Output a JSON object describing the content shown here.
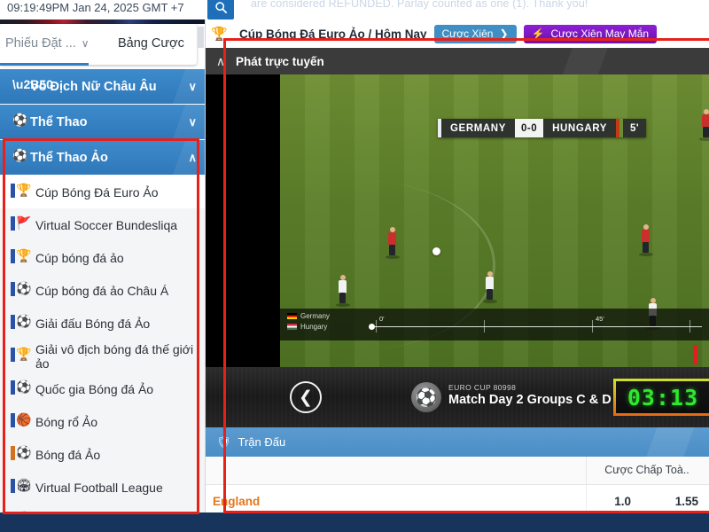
{
  "topbar": {
    "clock": "09:19:49PM Jan 24, 2025 GMT +7",
    "ticker": "are considered REFUNDED. Parlay counted as one (1). Thank you!",
    "search_icon": "search-icon"
  },
  "sidebar": {
    "tabs": {
      "bet_slip": "Phiếu Đặt ...",
      "bet_slip_chevron": "∨",
      "bet_board": "Bảng Cược"
    },
    "groups": [
      {
        "label": "Vô Địch Nữ Châu Âu",
        "chevron": "∨",
        "icon": "trophy-star-icon",
        "expanded": false
      },
      {
        "label": "Thể Thao",
        "chevron": "∨",
        "icon": "sports-ball-icon",
        "expanded": false
      },
      {
        "label": "Thể Thao Ảo",
        "chevron": "∧",
        "icon": "virtual-sports-icon",
        "expanded": true
      }
    ],
    "items": [
      {
        "label": "Cúp Bóng Đá Euro Ảo",
        "icon": "euro-cup-icon",
        "bar": "#2a53a8",
        "glyph": "🏆"
      },
      {
        "label": "Virtual Soccer Bundesliqa",
        "icon": "bundesliga-icon",
        "bar": "#2a53a8",
        "glyph": "🚩"
      },
      {
        "label": "Cúp bóng đá ảo",
        "icon": "virtual-cup-icon",
        "bar": "#2a53a8",
        "glyph": "🏆"
      },
      {
        "label": "Cúp bóng đá ảo Châu Á",
        "icon": "asia-cup-icon",
        "bar": "#2a53a8",
        "glyph": "⚽"
      },
      {
        "label": "Giải đấu Bóng đá Ảo",
        "icon": "virtual-league-icon",
        "bar": "#2a53a8",
        "glyph": "⚽"
      },
      {
        "label": "Giải vô địch bóng đá thế giới ảo",
        "icon": "world-cup-icon",
        "bar": "#2a53a8",
        "glyph": "🏆"
      },
      {
        "label": "Quốc gia Bóng đá Ảo",
        "icon": "nations-icon",
        "bar": "#2a53a8",
        "glyph": "⚽"
      },
      {
        "label": "Bóng rổ Ảo",
        "icon": "virtual-basketball-icon",
        "bar": "#2a53a8",
        "glyph": "🏀"
      },
      {
        "label": "Bóng đá Ảo",
        "icon": "virtual-football-icon",
        "bar": "#d4701e",
        "glyph": "⚽"
      },
      {
        "label": "Virtual Football League",
        "icon": "virtual-football-league-icon",
        "bar": "#2a53a8",
        "glyph": "🏟"
      }
    ]
  },
  "breadcrumb": {
    "icon": "trophy-icon",
    "text": "Cúp Bóng Đá Euro Ảo / Hôm Nay",
    "parlay_button": "Cược Xiên",
    "parlay_chevron": "❯",
    "lucky_parlay_icon": "lightning-icon",
    "lucky_parlay_button": "Cược Xiên May Mắn"
  },
  "stream": {
    "chevron": "∧",
    "title": "Phát trực tuyến",
    "scoreboard": {
      "home": "GERMANY",
      "score": "0-0",
      "away": "HUNGARY",
      "minute": "5'"
    },
    "timeline": {
      "home": "Germany",
      "away": "Hungary",
      "start_label": "0'",
      "half_label": "45'"
    },
    "controls": {
      "back_icon": "chevron-left-icon",
      "cup_icon": "soccer-player-icon",
      "event_id": "EURO CUP 80998",
      "event_title": "Match Day 2 Groups C & D",
      "timer": "03:13"
    }
  },
  "match_panel": {
    "icon": "shield-icon",
    "title": "Trận Đấu",
    "column_header": "Cược Chấp Toà..",
    "rows": [
      {
        "team": "England",
        "handicap": "1.0",
        "odds": "1.55"
      }
    ]
  },
  "colors": {
    "accent_blue": "#3d8bcc",
    "header_blue": "#4b8dc6",
    "purple": "#8018c8",
    "annotation_red": "#e8201a",
    "team_orange": "#e2761b",
    "timer_green": "#2ee82e"
  }
}
